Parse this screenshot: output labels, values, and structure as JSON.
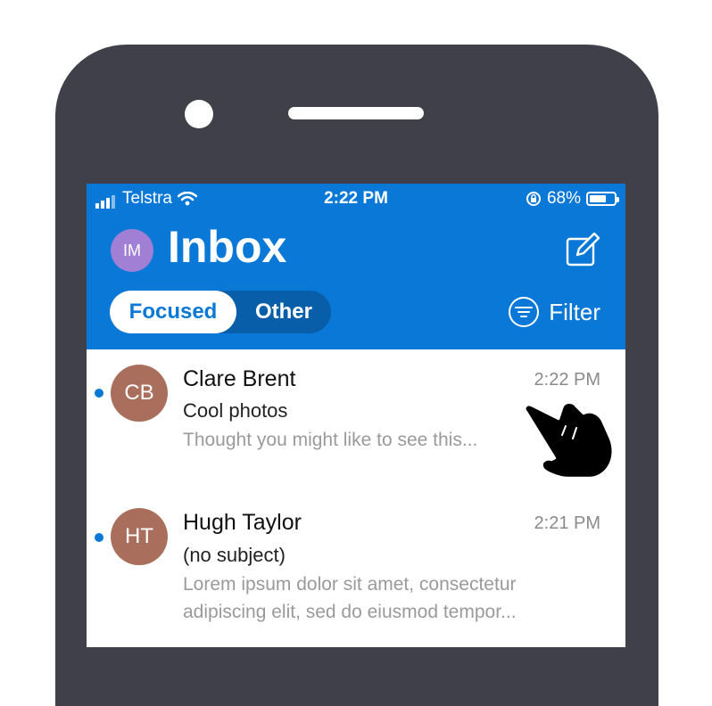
{
  "status_bar": {
    "carrier": "Telstra",
    "time": "2:22 PM",
    "battery_percent": "68%",
    "battery_level": 0.68
  },
  "header": {
    "avatar_initials": "IM",
    "title": "Inbox",
    "tabs": [
      {
        "label": "Focused",
        "selected": true
      },
      {
        "label": "Other",
        "selected": false
      }
    ],
    "filter_label": "Filter"
  },
  "messages": [
    {
      "initials": "CB",
      "sender": "Clare Brent",
      "time": "2:22 PM",
      "subject": "Cool photos",
      "preview": "Thought you might like to see this...",
      "unread": true
    },
    {
      "initials": "HT",
      "sender": "Hugh Taylor",
      "time": "2:21 PM",
      "subject": "(no subject)",
      "preview": "Lorem ipsum dolor sit amet, consectetur adipiscing elit, sed do eiusmod tempor...",
      "unread": true
    }
  ],
  "colors": {
    "accent": "#0a78d6",
    "phone_frame": "#3f4049",
    "avatar_me": "#a07fd4",
    "avatar_contact": "#a96f5c"
  },
  "icons": {
    "signal": "cellular-signal-icon",
    "wifi": "wifi-icon",
    "rotation_lock": "rotation-lock-icon",
    "battery": "battery-icon",
    "compose": "compose-icon",
    "filter": "filter-icon",
    "pointer": "pointing-hand-icon"
  }
}
